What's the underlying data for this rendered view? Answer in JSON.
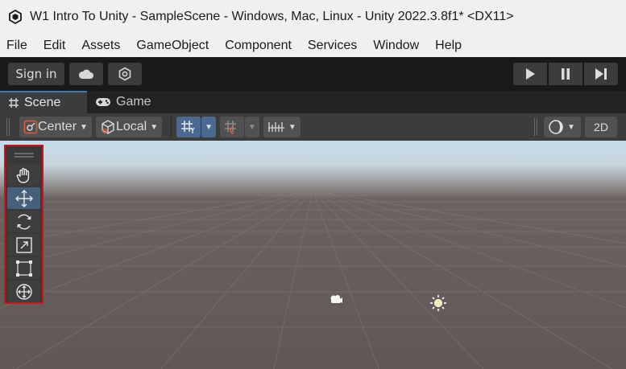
{
  "window": {
    "title": "W1 Intro To Unity - SampleScene - Windows, Mac, Linux - Unity 2022.3.8f1* <DX11>"
  },
  "menu": {
    "items": [
      "File",
      "Edit",
      "Assets",
      "GameObject",
      "Component",
      "Services",
      "Window",
      "Help"
    ]
  },
  "toolbar": {
    "sign_in": "Sign in",
    "icons": [
      "cloud-icon",
      "collab-icon"
    ],
    "play_controls": [
      "play-icon",
      "pause-icon",
      "step-icon"
    ]
  },
  "tabs": {
    "scene": "Scene",
    "game": "Game"
  },
  "scene_toolbar": {
    "pivot": "Center",
    "space": "Local",
    "mode_2d": "2D"
  },
  "tools": [
    "hand-tool",
    "move-tool",
    "rotate-tool",
    "scale-tool",
    "rect-tool",
    "transform-tool"
  ],
  "colors": {
    "highlight_border": "#d0121b",
    "active_tool": "#46607c",
    "accent_blue": "#3a79bb"
  }
}
